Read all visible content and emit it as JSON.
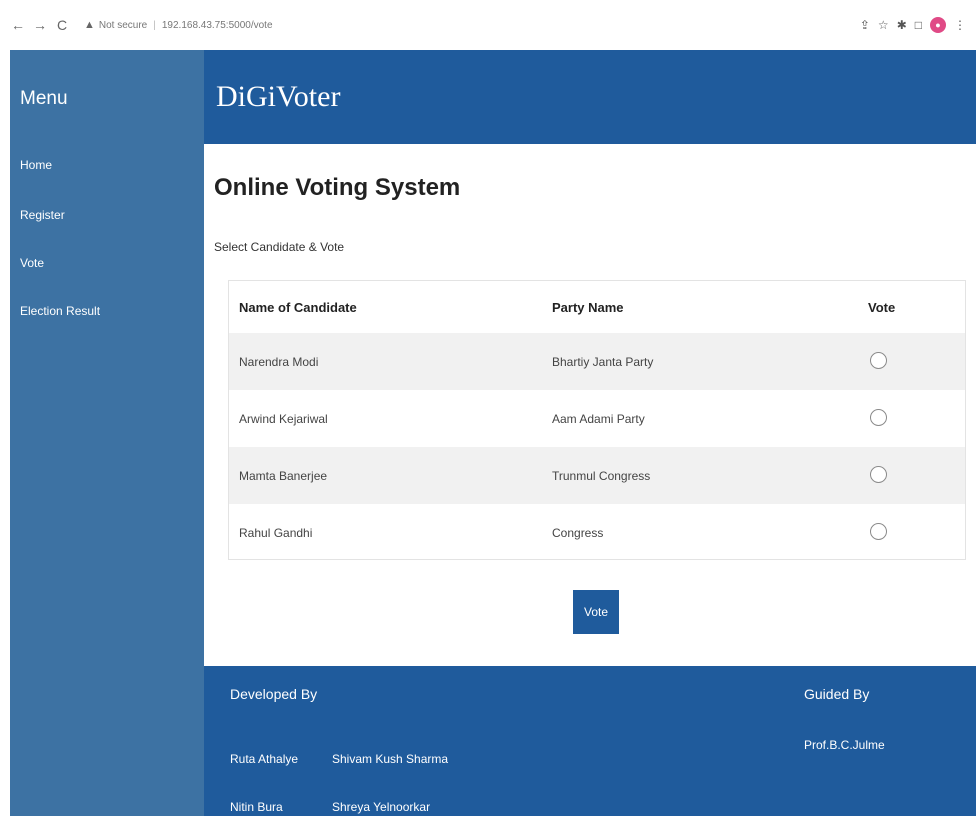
{
  "browser": {
    "back_icon": "←",
    "forward_icon": "→",
    "reload_icon": "C",
    "security_icon": "▲",
    "security_label": "Not secure",
    "url": "192.168.43.75:5000/vote",
    "share_icon": "⇪",
    "bookmark_icon": "☆",
    "extensions_icon": "✱",
    "window_icon": "□",
    "profile_initial": "●",
    "more_icon": "⋮"
  },
  "sidebar": {
    "title": "Menu",
    "items": [
      {
        "label": "Home"
      },
      {
        "label": "Register"
      },
      {
        "label": "Vote"
      },
      {
        "label": "Election Result"
      }
    ]
  },
  "header": {
    "brand": "DiGiVoter"
  },
  "main": {
    "title": "Online Voting System",
    "subtitle": "Select Candidate & Vote",
    "table": {
      "headers": [
        "Name of Candidate",
        "Party Name",
        "Vote"
      ],
      "rows": [
        {
          "candidate": "Narendra Modi",
          "party": "Bhartiy Janta Party"
        },
        {
          "candidate": "Arwind Kejariwal",
          "party": "Aam Adami Party"
        },
        {
          "candidate": "Mamta Banerjee",
          "party": "Trunmul Congress"
        },
        {
          "candidate": "Rahul Gandhi",
          "party": "Congress"
        }
      ]
    },
    "vote_button": "Vote"
  },
  "footer": {
    "developed_title": "Developed By",
    "developers": [
      "Ruta Athalye",
      "Shivam Kush Sharma",
      "Nitin Bura",
      "Shreya Yelnoorkar"
    ],
    "guided_title": "Guided By",
    "guide": "Prof.B.C.Julme"
  }
}
